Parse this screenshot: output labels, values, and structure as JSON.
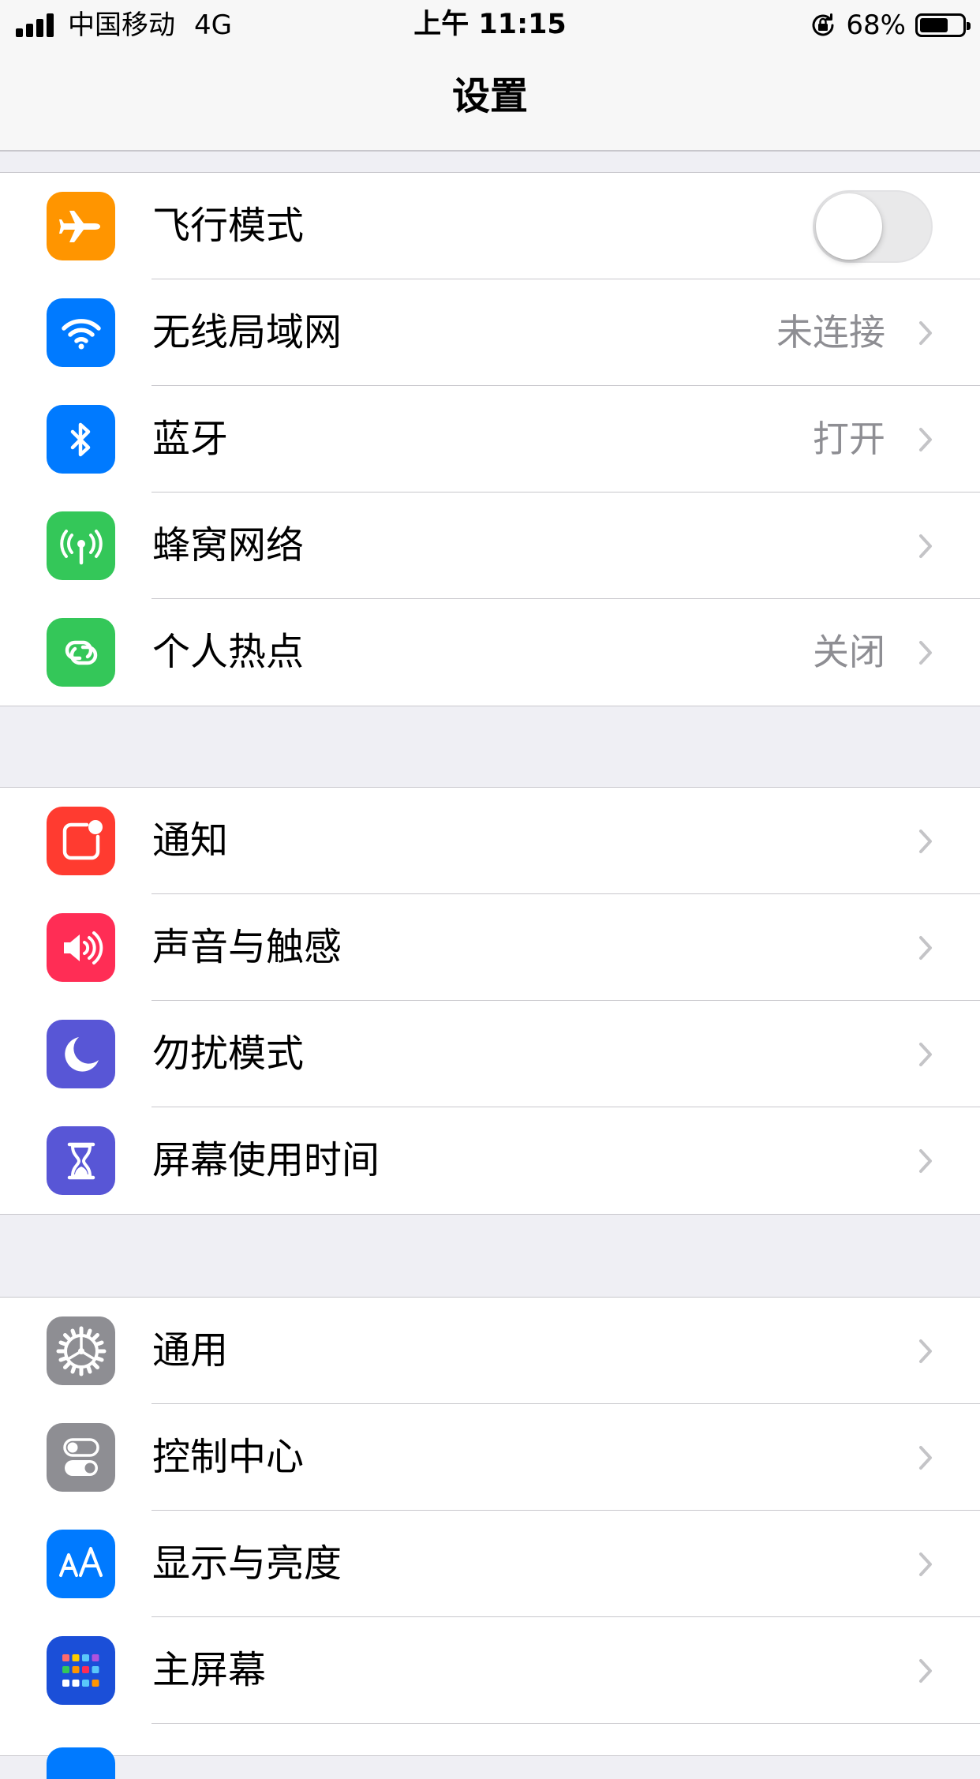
{
  "status_bar": {
    "carrier": "中国移动",
    "network": "4G",
    "time": "上午 11:15",
    "battery_percent": "68%",
    "battery_level": 0.68,
    "icons": [
      "signal-icon",
      "orientation-lock-icon",
      "battery-icon"
    ]
  },
  "nav": {
    "title": "设置"
  },
  "colors": {
    "airplane": "#ff9500",
    "wifi": "#007aff",
    "bluetooth": "#007aff",
    "cellular": "#34c759",
    "hotspot": "#34c759",
    "notifications": "#ff3b30",
    "sounds": "#ff2d55",
    "dnd": "#5856d6",
    "screen_time": "#5856d6",
    "general": "#8e8e93",
    "control_center": "#8e8e93",
    "display": "#007aff",
    "home_screen": "#1b4fd8",
    "secondary_text": "#8e8e93"
  },
  "groups": [
    {
      "items": [
        {
          "label": "飞行模式",
          "icon": "airplane-icon",
          "toggle": false
        },
        {
          "label": "无线局域网",
          "icon": "wifi-icon",
          "value": "未连接"
        },
        {
          "label": "蓝牙",
          "icon": "bluetooth-icon",
          "value": "打开"
        },
        {
          "label": "蜂窝网络",
          "icon": "cellular-antenna-icon",
          "value": ""
        },
        {
          "label": "个人热点",
          "icon": "hotspot-link-icon",
          "value": "关闭"
        }
      ]
    },
    {
      "items": [
        {
          "label": "通知",
          "icon": "notifications-icon"
        },
        {
          "label": "声音与触感",
          "icon": "speaker-icon"
        },
        {
          "label": "勿扰模式",
          "icon": "moon-icon"
        },
        {
          "label": "屏幕使用时间",
          "icon": "hourglass-icon"
        }
      ]
    },
    {
      "items": [
        {
          "label": "通用",
          "icon": "gear-icon"
        },
        {
          "label": "控制中心",
          "icon": "toggles-icon"
        },
        {
          "label": "显示与亮度",
          "icon": "text-size-aa-icon"
        },
        {
          "label": "主屏幕",
          "icon": "app-grid-icon"
        }
      ]
    }
  ]
}
